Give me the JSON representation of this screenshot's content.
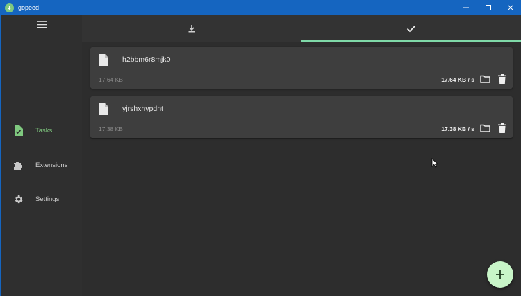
{
  "window": {
    "title": "gopeed"
  },
  "sidebar": {
    "items": [
      {
        "label": "Tasks",
        "icon": "tasks-icon",
        "active": true
      },
      {
        "label": "Extensions",
        "icon": "puzzle-icon",
        "active": false
      },
      {
        "label": "Settings",
        "icon": "gear-icon",
        "active": false
      }
    ]
  },
  "tabs": [
    {
      "icon": "download-icon",
      "active": false
    },
    {
      "icon": "check-icon",
      "active": true
    }
  ],
  "tasks": [
    {
      "name": "h2bbm6r8mjk0",
      "size": "17.64 KB",
      "speed": "17.64 KB / s"
    },
    {
      "name": "yjrshxhypdnt",
      "size": "17.38 KB",
      "speed": "17.38 KB / s"
    }
  ],
  "colors": {
    "accent": "#7fc97f",
    "titlebar": "#1565c0",
    "tab_indicator": "#7fd9a8",
    "fab": "#c8f5c8"
  }
}
